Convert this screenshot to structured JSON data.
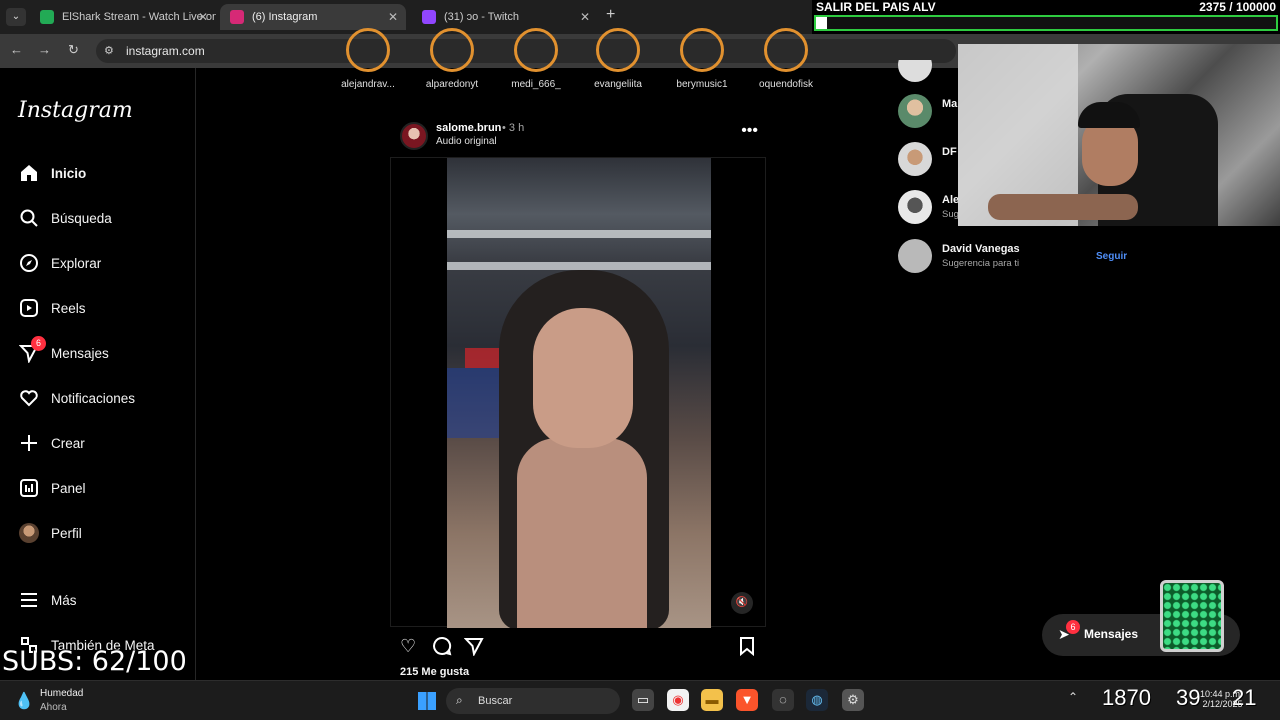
{
  "browser": {
    "tabs": [
      {
        "title": "ElShark Stream - Watch Live on",
        "color": "#22aa55"
      },
      {
        "title": "(6) Instagram",
        "color": "#d62976"
      },
      {
        "title": "(31) ɔo - Twitch",
        "color": "#9146ff"
      }
    ],
    "url": "instagram.com"
  },
  "goal": {
    "title": "SALIR DEL PAIS ALV",
    "count": "2375 / 100000",
    "progress_percent": 2.375
  },
  "sidebar": {
    "logo": "Instagram",
    "items": [
      {
        "label": "Inicio",
        "icon": "home-icon"
      },
      {
        "label": "Búsqueda",
        "icon": "search-icon"
      },
      {
        "label": "Explorar",
        "icon": "compass-icon"
      },
      {
        "label": "Reels",
        "icon": "reels-icon"
      },
      {
        "label": "Mensajes",
        "icon": "messenger-icon",
        "badge": "6"
      },
      {
        "label": "Notificaciones",
        "icon": "heart-icon"
      },
      {
        "label": "Crear",
        "icon": "plus-icon"
      },
      {
        "label": "Panel",
        "icon": "dashboard-icon"
      },
      {
        "label": "Perfil",
        "icon": "profile-icon"
      },
      {
        "label": "Más",
        "icon": "menu-icon"
      },
      {
        "label": "También de Meta",
        "icon": "meta-icon"
      }
    ]
  },
  "stories": [
    "alejandrav...",
    "alparedonyt",
    "medi_666_",
    "evangeliita",
    "berymusic1",
    "oquendofisk"
  ],
  "post": {
    "username": "salome.brun",
    "time": "• 3 h",
    "audio": "Audio original",
    "likes": "215 Me gusta"
  },
  "suggestions": [
    {
      "name": "Ma",
      "sub": ""
    },
    {
      "name": "DF",
      "sub": ""
    },
    {
      "name": "Ale",
      "sub": "Sug"
    },
    {
      "name": "David Vanegas",
      "sub": "Sugerencia para ti",
      "action": "Seguir"
    }
  ],
  "messages_pill": {
    "label": "Mensajes",
    "badge": "6"
  },
  "subs_overlay": "SUBS: 62/100",
  "taskbar": {
    "weather_title": "Humedad",
    "weather_sub": "Ahora",
    "search_label": "Buscar",
    "counter_a": "1870",
    "counter_b": "39",
    "counter_c": "21",
    "time": "10:44 p.m.",
    "date": "2/12/2025"
  }
}
